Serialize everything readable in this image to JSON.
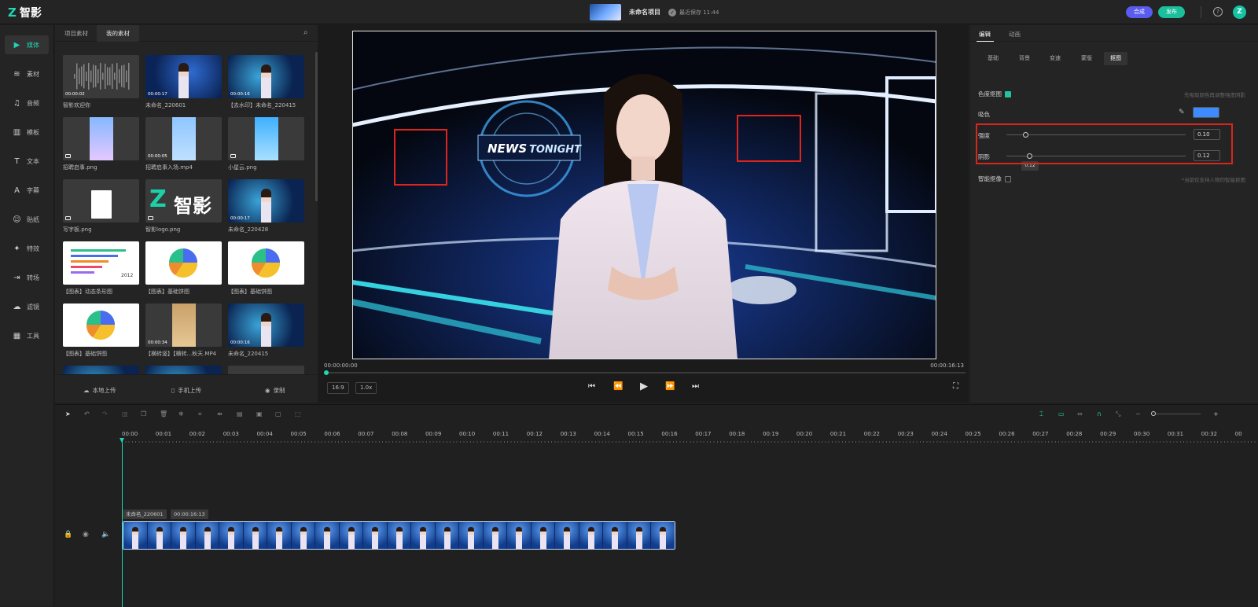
{
  "app": {
    "logo_text": "智影",
    "project_name": "未命名项目",
    "save_status": "最近保存 11:44",
    "compose_label": "合成",
    "publish_label": "发布",
    "help_label": "?",
    "avatar_letter": "Z"
  },
  "sidenav": {
    "items": [
      {
        "label": "媒体",
        "icon": "media-icon",
        "active": true
      },
      {
        "label": "素材",
        "icon": "layers-icon"
      },
      {
        "label": "音频",
        "icon": "music-icon"
      },
      {
        "label": "模板",
        "icon": "template-icon"
      },
      {
        "label": "文本",
        "icon": "text-icon"
      },
      {
        "label": "字幕",
        "icon": "subtitle-icon"
      },
      {
        "label": "贴纸",
        "icon": "sticker-icon"
      },
      {
        "label": "特效",
        "icon": "effects-icon"
      },
      {
        "label": "转场",
        "icon": "transition-icon"
      },
      {
        "label": "滤镜",
        "icon": "filter-icon"
      },
      {
        "label": "工具",
        "icon": "tools-icon"
      }
    ]
  },
  "library": {
    "tabs": [
      "项目素材",
      "我的素材"
    ],
    "active_tab": "我的素材",
    "tiles": [
      {
        "caption": "智影欢迎你",
        "duration": "00:00:02",
        "kind": "audio"
      },
      {
        "caption": "未命名_220601",
        "duration": "00:00:17",
        "kind": "news"
      },
      {
        "caption": "【去水印】未命名_220415",
        "duration": "00:00:16",
        "kind": "news2"
      },
      {
        "caption": "招聘启事.png",
        "duration": "",
        "kind": "poster"
      },
      {
        "caption": "招聘启事入场.mp4",
        "duration": "00:00:05",
        "kind": "blue"
      },
      {
        "caption": "小星云.png",
        "duration": "",
        "kind": "sky"
      },
      {
        "caption": "写字板.png",
        "duration": "",
        "kind": "paper"
      },
      {
        "caption": "智影logo.png",
        "duration": "",
        "kind": "logo"
      },
      {
        "caption": "未命名_220428",
        "duration": "00:00:17",
        "kind": "news2"
      },
      {
        "caption": "【图表】动态条形图",
        "duration": "",
        "kind": "bars"
      },
      {
        "caption": "【图表】基础饼图",
        "duration": "",
        "kind": "pie"
      },
      {
        "caption": "【图表】基础饼图",
        "duration": "",
        "kind": "pie"
      },
      {
        "caption": "【图表】基础饼图",
        "duration": "",
        "kind": "pie"
      },
      {
        "caption": "【横转竖】【横转...秋天.MP4",
        "duration": "00:00:34",
        "kind": "autumn"
      },
      {
        "caption": "未命名_220415",
        "duration": "00:00:16",
        "kind": "news2"
      }
    ],
    "bars_year": "2012",
    "logo_text": "智影",
    "upload_local": "本地上传",
    "upload_phone": "手机上传",
    "record": "录制"
  },
  "preview": {
    "time_current": "00:00:00:00",
    "time_total": "00:00:16:13",
    "aspect": "16:9",
    "speed": "1.0x",
    "overlay_text_1": "NEWS",
    "overlay_text_2": "TONIGHT",
    "progress": 0
  },
  "inspector": {
    "tabs": [
      "编辑",
      "动画"
    ],
    "active_tab": "编辑",
    "subtabs": [
      "基础",
      "背景",
      "变速",
      "蒙版",
      "抠图"
    ],
    "active_subtab": "抠图",
    "chroma_label": "色度抠图",
    "chroma_hint": "先吸取颜色再调整强度阴影",
    "eyedrop_label": "吸色",
    "swatch_color": "#3d8bff",
    "strength_label": "强度",
    "strength_value": "0.10",
    "strength_tooltip": "0.12",
    "shadow_label": "阴影",
    "shadow_value": "0.12",
    "smart_label": "智能抠像",
    "smart_hint": "*当前仅支持人物的智能抠图"
  },
  "timeline": {
    "ticks": [
      "00:00",
      "00:01",
      "00:02",
      "00:03",
      "00:04",
      "00:05",
      "00:06",
      "00:07",
      "00:08",
      "00:09",
      "00:10",
      "00:11",
      "00:12",
      "00:13",
      "00:14",
      "00:15",
      "00:16",
      "00:17",
      "00:18",
      "00:19",
      "00:20",
      "00:21",
      "00:22",
      "00:23",
      "00:24",
      "00:25",
      "00:26",
      "00:27",
      "00:28",
      "00:29",
      "00:30",
      "00:31",
      "00:32",
      "00"
    ],
    "clip_name": "未命名_220601",
    "clip_duration": "00:00:16:13",
    "frames": 23
  }
}
